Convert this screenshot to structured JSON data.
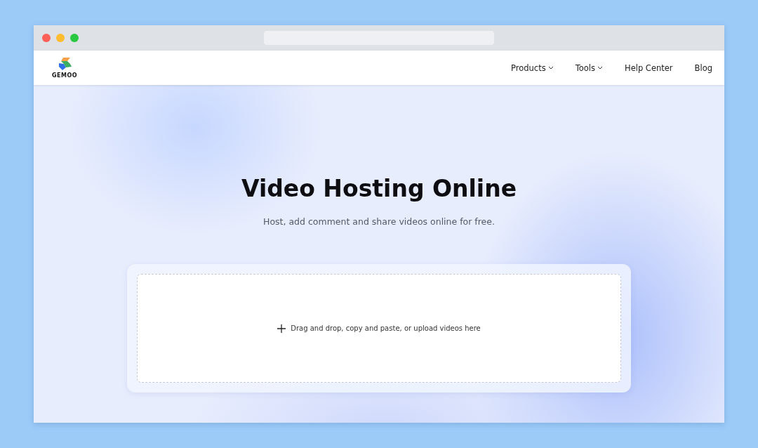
{
  "header": {
    "logo": {
      "text": "GEMOO"
    },
    "nav": [
      {
        "label": "Products",
        "kind": "dropdown"
      },
      {
        "label": "Tools",
        "kind": "dropdown"
      },
      {
        "label": "Help Center",
        "kind": "link"
      },
      {
        "label": "Blog",
        "kind": "link"
      }
    ]
  },
  "hero": {
    "title": "Video Hosting Online",
    "subtitle": "Host, add comment and share videos online for free."
  },
  "upload": {
    "prompt": "Drag and drop, copy and paste, or upload videos here"
  }
}
